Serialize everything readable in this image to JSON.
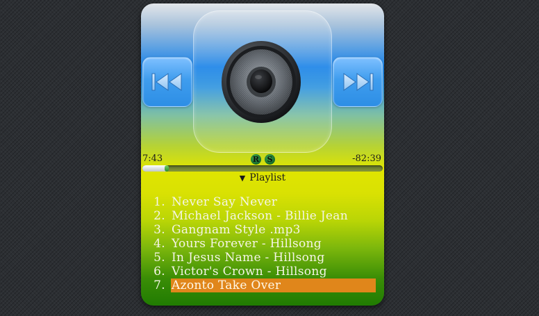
{
  "player": {
    "elapsed_time": "7:43",
    "remaining_time": "-82:39",
    "progress_fraction": 0.1,
    "repeat_label": "R",
    "shuffle_label": "S",
    "playlist_toggle_label": "Playlist",
    "playlist_toggle_arrow": "▼",
    "prev_icon": "skip-back-icon",
    "next_icon": "skip-forward-icon",
    "speaker_icon": "speaker-icon",
    "highlight_color": "#e0861b"
  },
  "playlist": {
    "tracks": [
      {
        "num": "1.",
        "title": "Never Say Never"
      },
      {
        "num": "2.",
        "title": "Michael Jackson - Billie Jean"
      },
      {
        "num": "3.",
        "title": "Gangnam Style .mp3"
      },
      {
        "num": "4.",
        "title": "Yours Forever - Hillsong"
      },
      {
        "num": "5.",
        "title": "In Jesus Name - Hillsong"
      },
      {
        "num": "6.",
        "title": "Victor's Crown - Hillsong"
      },
      {
        "num": "7.",
        "title": "Azonto Take Over"
      }
    ],
    "active_index": 6
  }
}
